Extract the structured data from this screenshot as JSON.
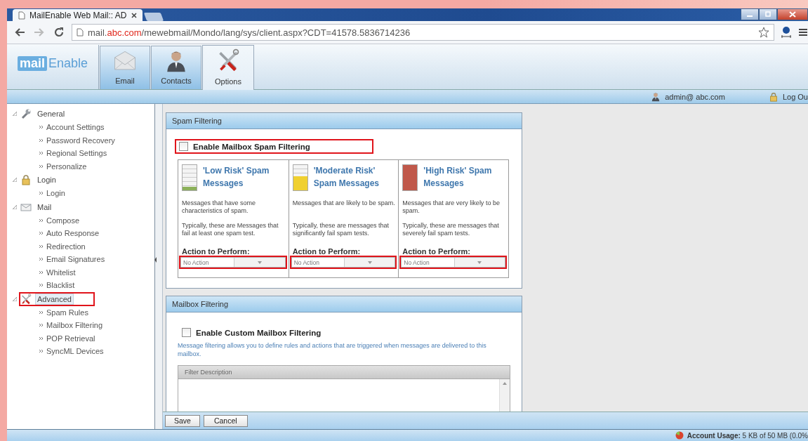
{
  "browser": {
    "tab_title": "MailEnable Web Mail:: AD",
    "url": {
      "prefix": "mail.",
      "domain": "abc.com",
      "path": "/mewebmail/Mondo/lang/sys/client.aspx?CDT=41578.5836714236"
    }
  },
  "app": {
    "logo": {
      "first": "mail",
      "second": "Enable"
    },
    "tabs": [
      {
        "label": "Email",
        "kind": "envelope",
        "selected": false
      },
      {
        "label": "Contacts",
        "kind": "person",
        "selected": false
      },
      {
        "label": "Options",
        "kind": "tools",
        "selected": true
      }
    ],
    "user": "admin@ abc.com",
    "logout": "Log Ou"
  },
  "sidebar": {
    "groups": [
      {
        "label": "General",
        "kind": "wrench",
        "expanded": true,
        "selected": false,
        "highlighted": false,
        "children": [
          {
            "label": "Account Settings"
          },
          {
            "label": "Password Recovery"
          },
          {
            "label": "Regional Settings"
          },
          {
            "label": "Personalize"
          }
        ]
      },
      {
        "label": "Login",
        "kind": "lock",
        "expanded": true,
        "selected": false,
        "highlighted": false,
        "children": [
          {
            "label": "Login"
          }
        ]
      },
      {
        "label": "Mail",
        "kind": "envelope",
        "expanded": true,
        "selected": false,
        "highlighted": false,
        "children": [
          {
            "label": "Compose"
          },
          {
            "label": "Auto Response"
          },
          {
            "label": "Redirection"
          },
          {
            "label": "Email Signatures"
          },
          {
            "label": "Whitelist"
          },
          {
            "label": "Blacklist"
          }
        ]
      },
      {
        "label": "Advanced",
        "kind": "tools",
        "expanded": true,
        "selected": true,
        "highlighted": true,
        "children": [
          {
            "label": "Spam Rules"
          },
          {
            "label": "Mailbox Filtering"
          },
          {
            "label": "POP Retrieval"
          },
          {
            "label": "SyncML Devices"
          }
        ]
      }
    ]
  },
  "spam_panel": {
    "title": "Spam Filtering",
    "enable": {
      "label": "Enable Mailbox Spam Filtering",
      "checked": false,
      "highlighted": true
    },
    "columns": [
      {
        "title": "'Low Risk' Spam Messages",
        "level": 0.15,
        "color": "#8cb15a",
        "description": "Messages that have some characteristics of spam.",
        "detail": "Typically, these are Messages that fail at least one spam test.",
        "action_label": "Action to Perform:",
        "action": {
          "value": "No Action",
          "highlighted": true
        }
      },
      {
        "title": "'Moderate Risk' Spam Messages",
        "level": 0.55,
        "color": "#f0d030",
        "description": "Messages that are likely to be spam.",
        "detail": "Typically, these are messages that significantly fail spam tests.",
        "action_label": "Action to Perform:",
        "action": {
          "value": "No Action",
          "highlighted": true
        }
      },
      {
        "title": "'High Risk' Spam Messages",
        "level": 1,
        "color": "#c0584a",
        "description": "Messages that are very likely to be spam.",
        "detail": "Typically, these are messages that severely fail spam tests.",
        "action_label": "Action to Perform:",
        "action": {
          "value": "No Action",
          "highlighted": true
        }
      }
    ]
  },
  "mailbox_panel": {
    "title": "Mailbox Filtering",
    "enable": {
      "label": "Enable Custom Mailbox Filtering",
      "checked": false
    },
    "description": "Message filtering allows you to define rules and actions that are triggered when messages are delivered to this mailbox.",
    "grid": {
      "columns": [
        "Filter Description"
      ]
    }
  },
  "buttons": [
    "Save",
    "Cancel"
  ],
  "status_bar": {
    "usage": "**Account Usage:** 5 KB of 50 MB (0.0%"
  }
}
